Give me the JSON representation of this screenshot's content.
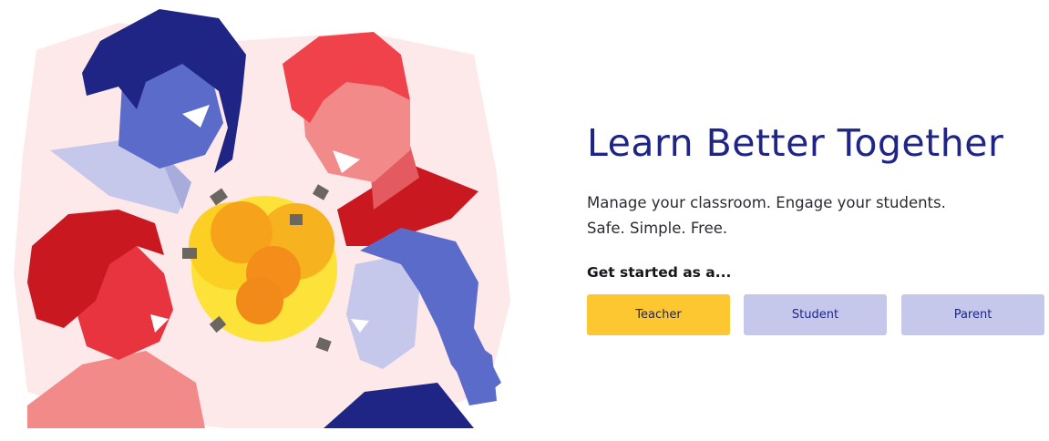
{
  "hero": {
    "title": "Learn Better Together",
    "subtitle_line1": "Manage your classroom. Engage your students.",
    "subtitle_line2": "Safe. Simple. Free.",
    "get_started_label": "Get started as a..."
  },
  "role_buttons": {
    "teacher": "Teacher",
    "student": "Student",
    "parent": "Parent"
  },
  "illustration": {
    "description_icon": "group-of-people-with-lightbulbs-illustration"
  },
  "colors": {
    "title": "#1f2585",
    "teacher_button": "#fcc731",
    "secondary_button": "#c5c8ea",
    "navy": "#1f2585",
    "red": "#e8343e",
    "coral": "#f28a8a",
    "periwinkle": "#5b6bc9",
    "yellow": "#fde23a",
    "orange": "#f7a21b",
    "blush": "#fde8ea"
  }
}
